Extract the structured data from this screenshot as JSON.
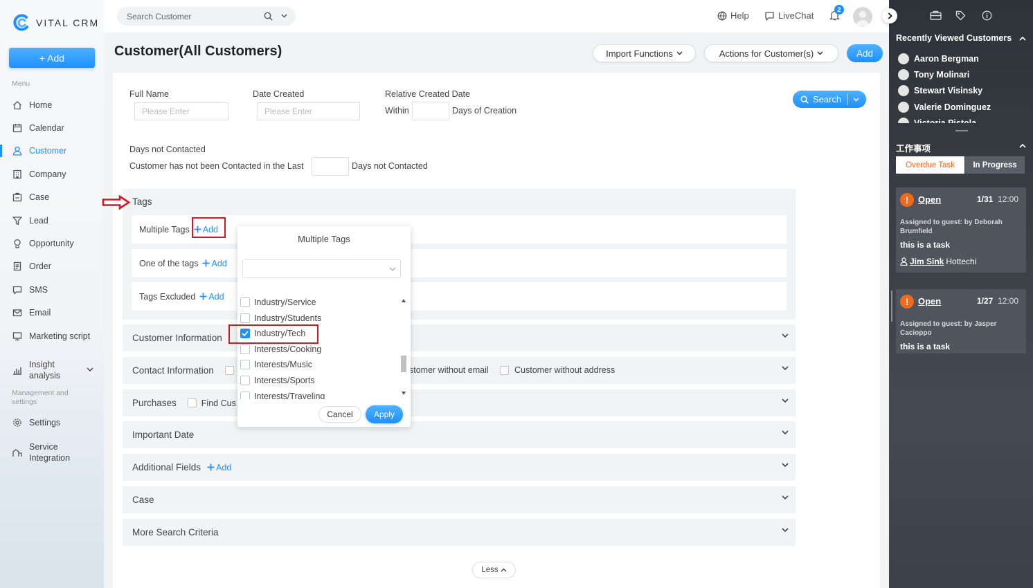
{
  "app": {
    "name": "VITAL CRM"
  },
  "sidebar": {
    "add_label": "+ Add",
    "menu_title": "Menu",
    "items": [
      {
        "label": "Home",
        "icon": "home-icon"
      },
      {
        "label": "Calendar",
        "icon": "calendar-icon"
      },
      {
        "label": "Customer",
        "icon": "customer-icon",
        "active": true
      },
      {
        "label": "Company",
        "icon": "company-icon"
      },
      {
        "label": "Case",
        "icon": "case-icon"
      },
      {
        "label": "Lead",
        "icon": "lead-icon"
      },
      {
        "label": "Opportunity",
        "icon": "opportunity-icon"
      },
      {
        "label": "Order",
        "icon": "order-icon"
      },
      {
        "label": "SMS",
        "icon": "sms-icon"
      },
      {
        "label": "Email",
        "icon": "email-icon"
      },
      {
        "label": "Marketing script",
        "icon": "marketing-icon"
      }
    ],
    "insight_line1": "Insight",
    "insight_line2": "analysis",
    "mgmt_line1": "Management and",
    "mgmt_line2": "settings",
    "settings": "Settings",
    "service_line1": "Service",
    "service_line2": "Integration"
  },
  "topbar": {
    "search_placeholder": "Search Customer",
    "help": "Help",
    "livechat": "LiveChat",
    "notification_count": "2"
  },
  "page": {
    "title": "Customer(All Customers)",
    "import_functions": "Import Functions",
    "actions": "Actions for Customer(s)",
    "add": "Add"
  },
  "filters": {
    "full_name_label": "Full Name",
    "full_name_placeholder": "Please Enter",
    "date_created_label": "Date Created",
    "date_created_placeholder": "Please Enter",
    "relative_label": "Relative Created Date",
    "within": "Within",
    "days_of_creation": "Days of Creation",
    "search": "Search",
    "days_not_contacted_label": "Days not Contacted",
    "not_contacted_prefix": "Customer has not been Contacted in the Last",
    "not_contacted_suffix": "Days not Contacted"
  },
  "tags": {
    "title": "Tags",
    "multiple": "Multiple Tags",
    "one_of": "One of the tags",
    "excluded": "Tags Excluded",
    "add": "Add"
  },
  "sections": {
    "customer_information": "Customer Information",
    "contact_information": "Contact Information",
    "customer_without_email": "stomer without email",
    "customer_without_address": "Customer without address",
    "purchases": "Purchases",
    "find_customer": "Find Cus",
    "important_date": "Important Date",
    "additional_fields": "Additional Fields",
    "additional_add": "Add",
    "case": "Case",
    "more": "More Search Criteria",
    "less": "Less"
  },
  "dropdown": {
    "title": "Multiple Tags",
    "options": [
      {
        "label": "Industry/Service",
        "checked": false
      },
      {
        "label": "Industry/Students",
        "checked": false
      },
      {
        "label": "Industry/Tech",
        "checked": true
      },
      {
        "label": "Interests/Cooking",
        "checked": false
      },
      {
        "label": "Interests/Music",
        "checked": false
      },
      {
        "label": "Interests/Sports",
        "checked": false
      },
      {
        "label": "Interests/Traveling",
        "checked": false
      }
    ],
    "cancel": "Cancel",
    "apply": "Apply"
  },
  "right_panel": {
    "recent_title": "Recently Viewed Customers",
    "recent": [
      "Aaron Bergman",
      "Tony Molinari",
      "Stewart Visinsky",
      "Valerie Dominguez",
      "Victoria Pistola"
    ],
    "work_title": "工作事项",
    "tab_overdue": "Overdue Task",
    "tab_progress": "In Progress",
    "tasks": [
      {
        "status": "Open",
        "date": "1/31",
        "time": "12:00",
        "assigned": "Assigned to guest: by Deborah Brumfield",
        "text": "this is a task",
        "contact": "Jim Sink",
        "company": "Hottechi"
      },
      {
        "status": "Open",
        "date": "1/27",
        "time": "12:00",
        "assigned": "Assigned to guest: by Jasper Cacioppo",
        "text": "this is a task"
      }
    ]
  },
  "colors": {
    "accent": "#1e90ff",
    "highlight": "#e0141e",
    "task_alert": "#f06a1d"
  }
}
